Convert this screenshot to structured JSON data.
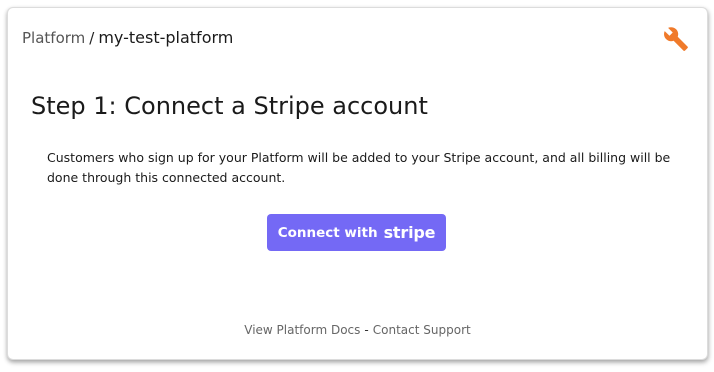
{
  "header": {
    "breadcrumb_parent": "Platform",
    "breadcrumb_separator": "/",
    "breadcrumb_current": "my-test-platform",
    "settings_icon": "wrench-icon"
  },
  "main": {
    "title": "Step 1: Connect a Stripe account",
    "description": "Customers who sign up for your Platform will be added to your Stripe account, and all billing will be done through this connected account.",
    "connect_button": {
      "prefix": "Connect with",
      "brand": "stripe"
    }
  },
  "footer": {
    "docs_link": "View Platform Docs",
    "separator": "-",
    "support_link": "Contact Support"
  },
  "colors": {
    "accent": "#7469f5",
    "icon": "#f07a2a"
  }
}
